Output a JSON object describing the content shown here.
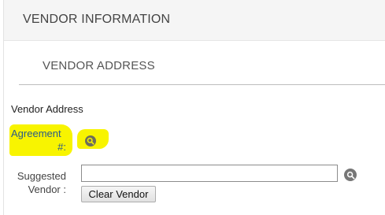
{
  "panel": {
    "title": "VENDOR INFORMATION"
  },
  "section": {
    "title": "VENDOR ADDRESS"
  },
  "subsection": {
    "label": "Vendor Address"
  },
  "agreement": {
    "label_line1": "Agreement",
    "label_line2": "#:",
    "lookup_icon": "search-icon"
  },
  "suggested_vendor": {
    "label_line1": "Suggested",
    "label_line2": "Vendor :",
    "value": "",
    "lookup_icon": "search-icon",
    "clear_button_label": "Clear Vendor"
  },
  "colors": {
    "highlight": "#f8f400",
    "header_background": "#f5f5f5",
    "agreement_label": "#2a5a8a"
  }
}
